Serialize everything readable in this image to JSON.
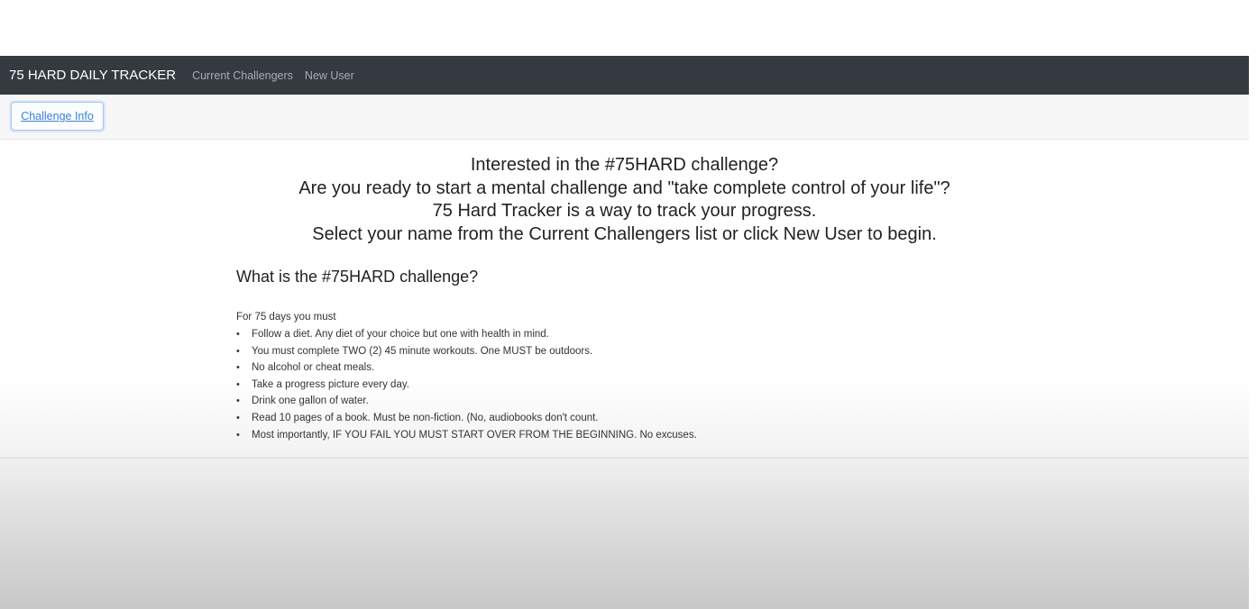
{
  "navbar": {
    "brand": "75 HARD DAILY TRACKER",
    "links": [
      {
        "label": "Current Challengers"
      },
      {
        "label": "New User"
      }
    ]
  },
  "toolbar": {
    "challenge_info_label": "Challenge Info"
  },
  "intro": {
    "lines": [
      "Interested in the #75HARD challenge?",
      "Are you ready to start a mental challenge and \"take complete control of your life\"?",
      "75 Hard Tracker is a way to track your progress.",
      "Select your name from the Current Challengers list or click New User to begin."
    ]
  },
  "section": {
    "heading": "What is the #75HARD challenge?",
    "rules_intro": "For 75 days you must",
    "bullet": "•",
    "rules": [
      "Follow a diet. Any diet of your choice but one with health in mind.",
      "You must complete TWO (2) 45 minute workouts. One MUST be outdoors.",
      "No alcohol or cheat meals.",
      "Take a progress picture every day.",
      "Drink one gallon of water.",
      "Read 10 pages of a book. Must be non-fiction. (No, audiobooks don't count.",
      "Most importantly, IF YOU FAIL YOU MUST START OVER FROM THE BEGINNING. No excuses."
    ]
  }
}
